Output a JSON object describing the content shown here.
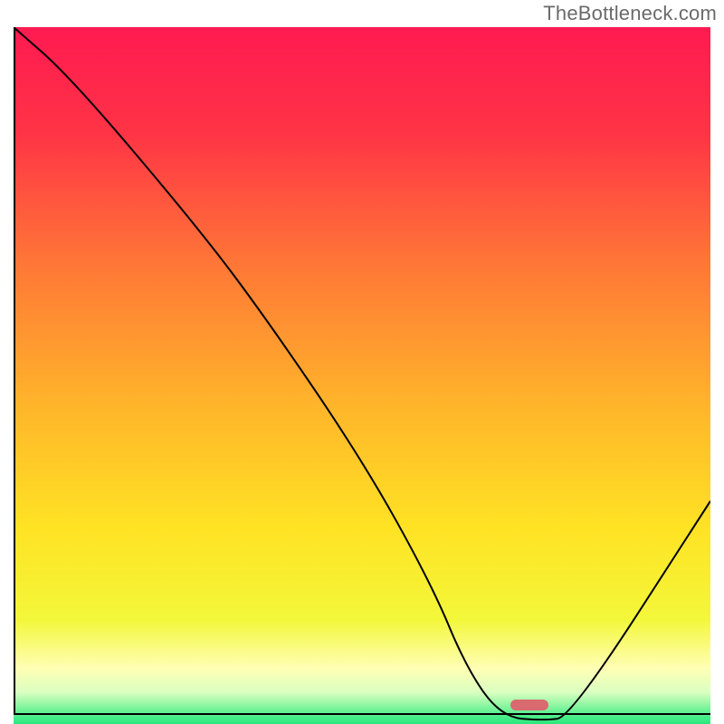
{
  "watermark": "TheBottleneck.com",
  "chart_data": {
    "type": "line",
    "title": "",
    "xlabel": "",
    "ylabel": "",
    "xlim": [
      0,
      100
    ],
    "ylim": [
      0,
      100
    ],
    "grid": false,
    "legend": false,
    "series": [
      {
        "name": "bottleneck-curve",
        "x": [
          0,
          8,
          25,
          35,
          50,
          60,
          65,
          70,
          76,
          80,
          100
        ],
        "y": [
          100,
          93,
          73,
          60,
          38,
          20,
          8,
          1,
          0.5,
          1,
          32
        ]
      }
    ],
    "markers": [
      {
        "name": "optimal-point",
        "x_center": 74,
        "width_pct": 5.5,
        "y": 0.4,
        "color": "#d96a6f"
      }
    ],
    "background_gradient": {
      "stops": [
        {
          "offset": 0.0,
          "color": "#ff1a51"
        },
        {
          "offset": 0.15,
          "color": "#ff3346"
        },
        {
          "offset": 0.35,
          "color": "#ff7a36"
        },
        {
          "offset": 0.55,
          "color": "#ffb72a"
        },
        {
          "offset": 0.72,
          "color": "#ffe324"
        },
        {
          "offset": 0.85,
          "color": "#f3f73a"
        },
        {
          "offset": 0.92,
          "color": "#ffffb5"
        },
        {
          "offset": 0.955,
          "color": "#d9ffc0"
        },
        {
          "offset": 0.985,
          "color": "#5cf08f"
        },
        {
          "offset": 1.0,
          "color": "#29e87c"
        }
      ]
    }
  }
}
